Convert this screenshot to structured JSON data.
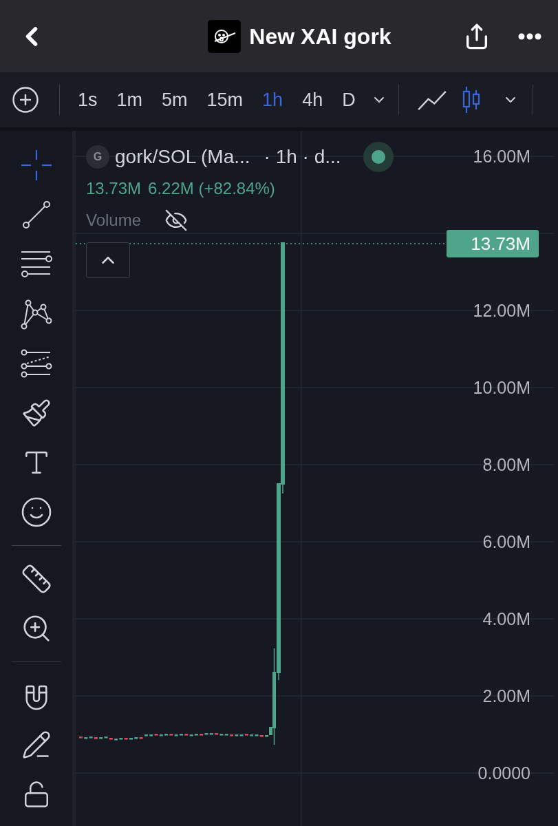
{
  "header": {
    "title": "New XAI gork"
  },
  "intervals": [
    {
      "label": "1s",
      "selected": false
    },
    {
      "label": "1m",
      "selected": false
    },
    {
      "label": "5m",
      "selected": false
    },
    {
      "label": "15m",
      "selected": false
    },
    {
      "label": "1h",
      "selected": true
    },
    {
      "label": "4h",
      "selected": false
    },
    {
      "label": "D",
      "selected": false
    }
  ],
  "chart_types": [
    {
      "kind": "line",
      "selected": false
    },
    {
      "kind": "candles",
      "selected": true
    }
  ],
  "tool_groups": [
    [
      {
        "kind": "crosshair",
        "selected": true
      },
      {
        "kind": "trend_line",
        "selected": false
      },
      {
        "kind": "channel",
        "selected": false
      },
      {
        "kind": "pattern",
        "selected": false
      },
      {
        "kind": "fib",
        "selected": false
      },
      {
        "kind": "brush",
        "selected": false
      },
      {
        "kind": "text",
        "selected": false
      },
      {
        "kind": "emoji",
        "selected": false
      }
    ],
    [
      {
        "kind": "ruler",
        "selected": false
      },
      {
        "kind": "zoom",
        "selected": false
      }
    ],
    [
      {
        "kind": "magnet",
        "selected": false
      },
      {
        "kind": "lock_drawings",
        "selected": false
      },
      {
        "kind": "lock",
        "selected": false
      }
    ]
  ],
  "legend": {
    "avatar": "G",
    "symbol": "gork/SOL (Ma...",
    "interval": "· 1h · d...",
    "last": "13.73M",
    "change": "6.22M (+82.84%)",
    "volume": {
      "label": "Volume",
      "hidden": true
    }
  },
  "price_axis": {
    "labels": [
      "16.00M",
      "12.00M",
      "10.00M",
      "8.00M",
      "6.00M",
      "4.00M",
      "2.00M",
      "0.0000"
    ],
    "last_price": "13.73M"
  }
}
